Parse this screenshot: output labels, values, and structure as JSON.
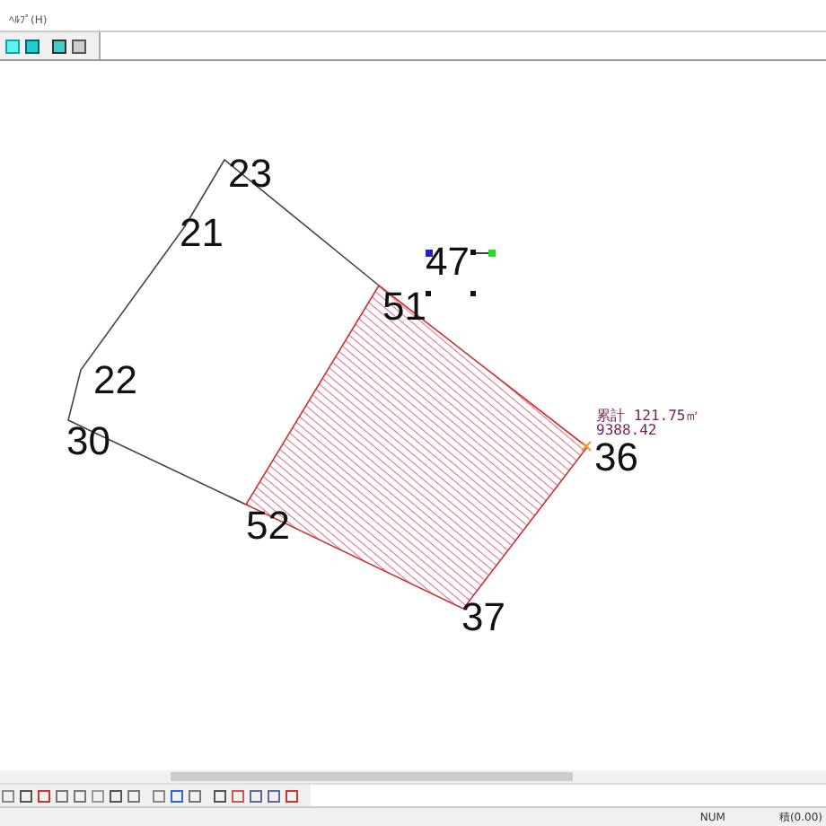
{
  "menu": [
    "ﾍﾙﾌﾟ(H)"
  ],
  "points": [
    {
      "label": "23"
    },
    {
      "label": "21"
    },
    {
      "label": "22"
    },
    {
      "label": "30"
    },
    {
      "label": "52"
    },
    {
      "label": "37"
    },
    {
      "label": "36"
    },
    {
      "label": "51"
    },
    {
      "label": "47"
    }
  ],
  "area_note": {
    "total": "累計 121.75㎡",
    "value": "9388.42"
  },
  "status_bar": [
    "NUM",
    "積(0.00)"
  ]
}
